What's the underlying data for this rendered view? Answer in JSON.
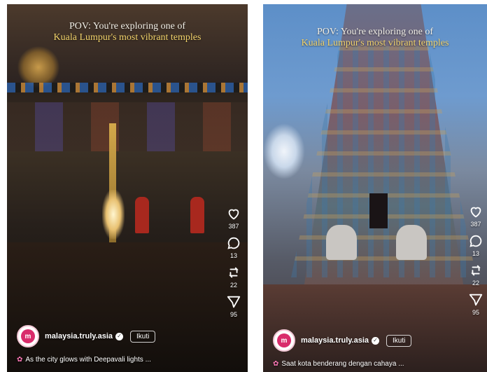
{
  "panels": [
    {
      "overlay_line1": "POV: You're exploring one of",
      "overlay_line2": "Kuala Lumpur's most vibrant temples",
      "account": {
        "avatar_text": "m",
        "handle": "malaysia.truly.asia",
        "follow_label": "Ikuti"
      },
      "caption": "As the city glows with Deepavali lights ...",
      "actions": {
        "like_count": "387",
        "comment_count": "13",
        "repost_count": "22",
        "share_count": "95"
      }
    },
    {
      "overlay_line1": "POV: You're exploring one of",
      "overlay_line2": "Kuala Lumpur's most vibrant temples",
      "account": {
        "avatar_text": "m",
        "handle": "malaysia.truly.asia",
        "follow_label": "Ikuti"
      },
      "caption": "Saat kota benderang dengan cahaya ...",
      "actions": {
        "like_count": "387",
        "comment_count": "13",
        "repost_count": "22",
        "share_count": "95"
      }
    }
  ],
  "colors": {
    "overlay_highlight": "#f2d36b",
    "brand_pink": "#d92b6b",
    "caption_emoji": "#ff79b8"
  },
  "icons": [
    "heart-icon",
    "comment-icon",
    "repost-icon",
    "send-icon",
    "verified-icon",
    "flower-icon"
  ]
}
